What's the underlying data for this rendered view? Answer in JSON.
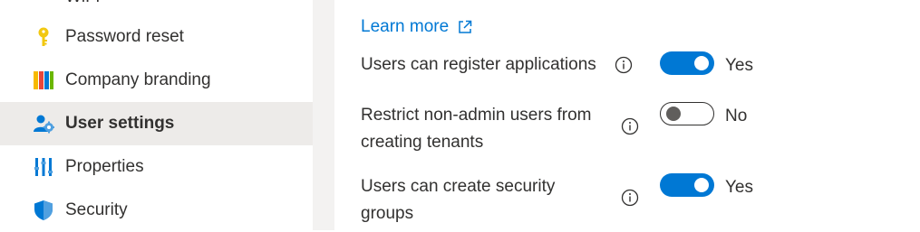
{
  "sidebar": {
    "partial_item_label": "WiFi",
    "items": [
      {
        "label": "Password reset",
        "icon": "key-icon"
      },
      {
        "label": "Company branding",
        "icon": "branding-icon"
      },
      {
        "label": "User settings",
        "icon": "user-settings-icon",
        "active": true
      },
      {
        "label": "Properties",
        "icon": "properties-icon"
      },
      {
        "label": "Security",
        "icon": "shield-icon"
      }
    ]
  },
  "main": {
    "learn_more": "Learn more",
    "settings": [
      {
        "label_lines": [
          "Users can register applications"
        ],
        "value": "Yes",
        "enabled": true
      },
      {
        "label_lines": [
          "Restrict non-admin users from",
          "creating tenants"
        ],
        "value": "No",
        "enabled": false
      },
      {
        "label_lines": [
          "Users can create security",
          "groups"
        ],
        "value": "Yes",
        "enabled": true
      }
    ]
  },
  "colors": {
    "accent": "#0078d4",
    "active_bg": "#edebe9",
    "text": "#323130"
  }
}
